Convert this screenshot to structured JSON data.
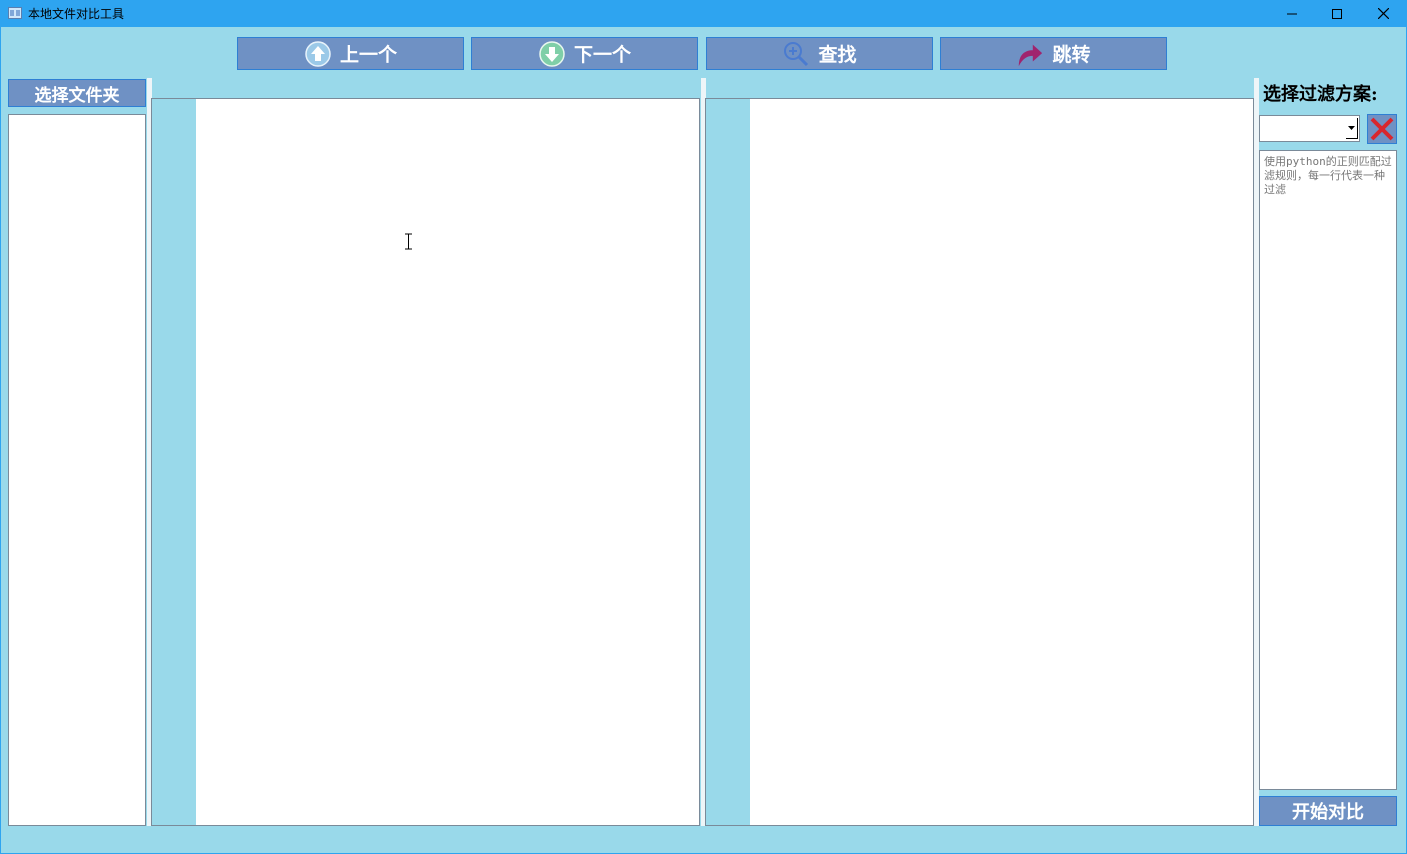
{
  "window": {
    "title": "本地文件对比工具"
  },
  "toolbar": {
    "prev_label": "上一个",
    "next_label": "下一个",
    "find_label": "查找",
    "jump_label": "跳转"
  },
  "left_panel": {
    "select_folder_label": "选择文件夹"
  },
  "right_panel": {
    "filter_label": "选择过滤方案:",
    "filter_select_value": "",
    "rules_placeholder": "使用python的正则匹配过滤规则，每一行代表一种过滤",
    "start_compare_label": "开始对比"
  },
  "colors": {
    "titlebar": "#2ea4f0",
    "background": "#99d9ea",
    "button": "#6f91c4",
    "delete_icon": "#d9262e",
    "jump_icon": "#a0246e"
  },
  "icons": {
    "prev": "arrow-up-circle-icon",
    "next": "arrow-down-circle-icon",
    "find": "zoom-in-icon",
    "jump": "curved-arrow-right-icon",
    "delete": "close-x-icon"
  }
}
